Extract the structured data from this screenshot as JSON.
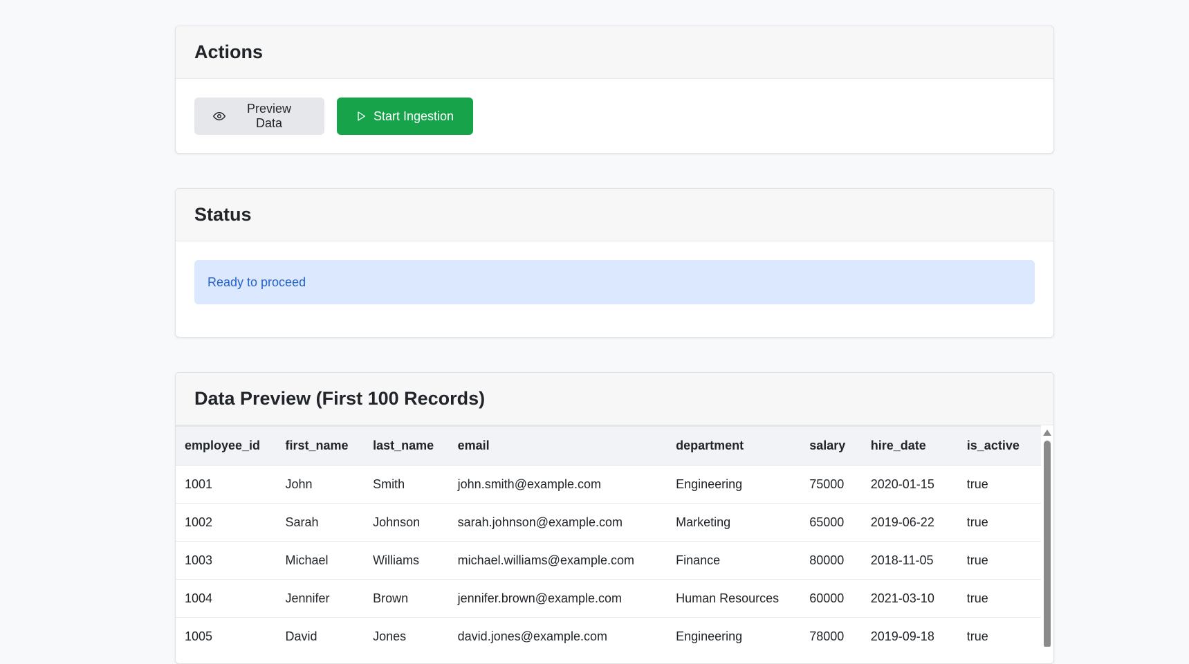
{
  "actions": {
    "title": "Actions",
    "preview_label": "Preview Data",
    "start_label": "Start Ingestion"
  },
  "status": {
    "title": "Status",
    "message": "Ready to proceed"
  },
  "preview": {
    "title": "Data Preview (First 100 Records)",
    "columns": [
      "employee_id",
      "first_name",
      "last_name",
      "email",
      "department",
      "salary",
      "hire_date",
      "is_active"
    ],
    "rows": [
      [
        "1001",
        "John",
        "Smith",
        "john.smith@example.com",
        "Engineering",
        "75000",
        "2020-01-15",
        "true"
      ],
      [
        "1002",
        "Sarah",
        "Johnson",
        "sarah.johnson@example.com",
        "Marketing",
        "65000",
        "2019-06-22",
        "true"
      ],
      [
        "1003",
        "Michael",
        "Williams",
        "michael.williams@example.com",
        "Finance",
        "80000",
        "2018-11-05",
        "true"
      ],
      [
        "1004",
        "Jennifer",
        "Brown",
        "jennifer.brown@example.com",
        "Human Resources",
        "60000",
        "2021-03-10",
        "true"
      ],
      [
        "1005",
        "David",
        "Jones",
        "david.jones@example.com",
        "Engineering",
        "78000",
        "2019-09-18",
        "true"
      ]
    ]
  },
  "icons": {
    "preview": "eye-icon",
    "start": "play-icon"
  },
  "colors": {
    "success": "#16a34a",
    "secondary": "#e5e7eb",
    "info_bg": "#dbe8fd",
    "info_text": "#2563c9"
  }
}
